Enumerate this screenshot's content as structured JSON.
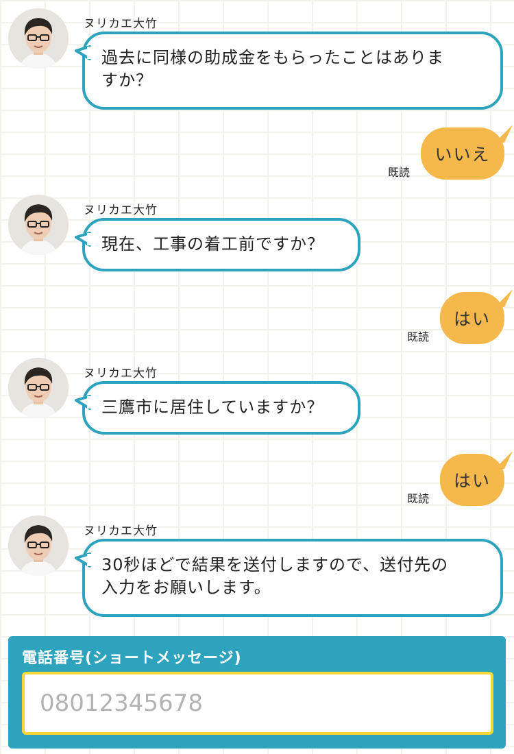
{
  "sender_name": "ヌリカエ大竹",
  "read_label": "既読",
  "colors": {
    "operator_bubble_border": "#2ea3bd",
    "user_bubble_fill": "#f5b84c",
    "input_panel": "#2ea3bd",
    "input_border": "#f7d63a"
  },
  "messages": [
    {
      "from": "operator",
      "line1": "過去に同様の助成金をもらったことはありま",
      "line2": "すか？"
    },
    {
      "from": "user",
      "text": "いいえ",
      "read": "既読"
    },
    {
      "from": "operator",
      "line1": "現在、工事の着工前ですか？"
    },
    {
      "from": "user",
      "text": "はい",
      "read": "既読"
    },
    {
      "from": "operator",
      "line1": "三鷹市に居住していますか？"
    },
    {
      "from": "user",
      "text": "はい",
      "read": "既読"
    },
    {
      "from": "operator",
      "line1": "30秒ほどで結果を送付しますので、送付先の",
      "line2": "入力をお願いします。"
    }
  ],
  "form": {
    "label": "電話番号(ショートメッセージ)",
    "placeholder": "08012345678",
    "value": ""
  }
}
